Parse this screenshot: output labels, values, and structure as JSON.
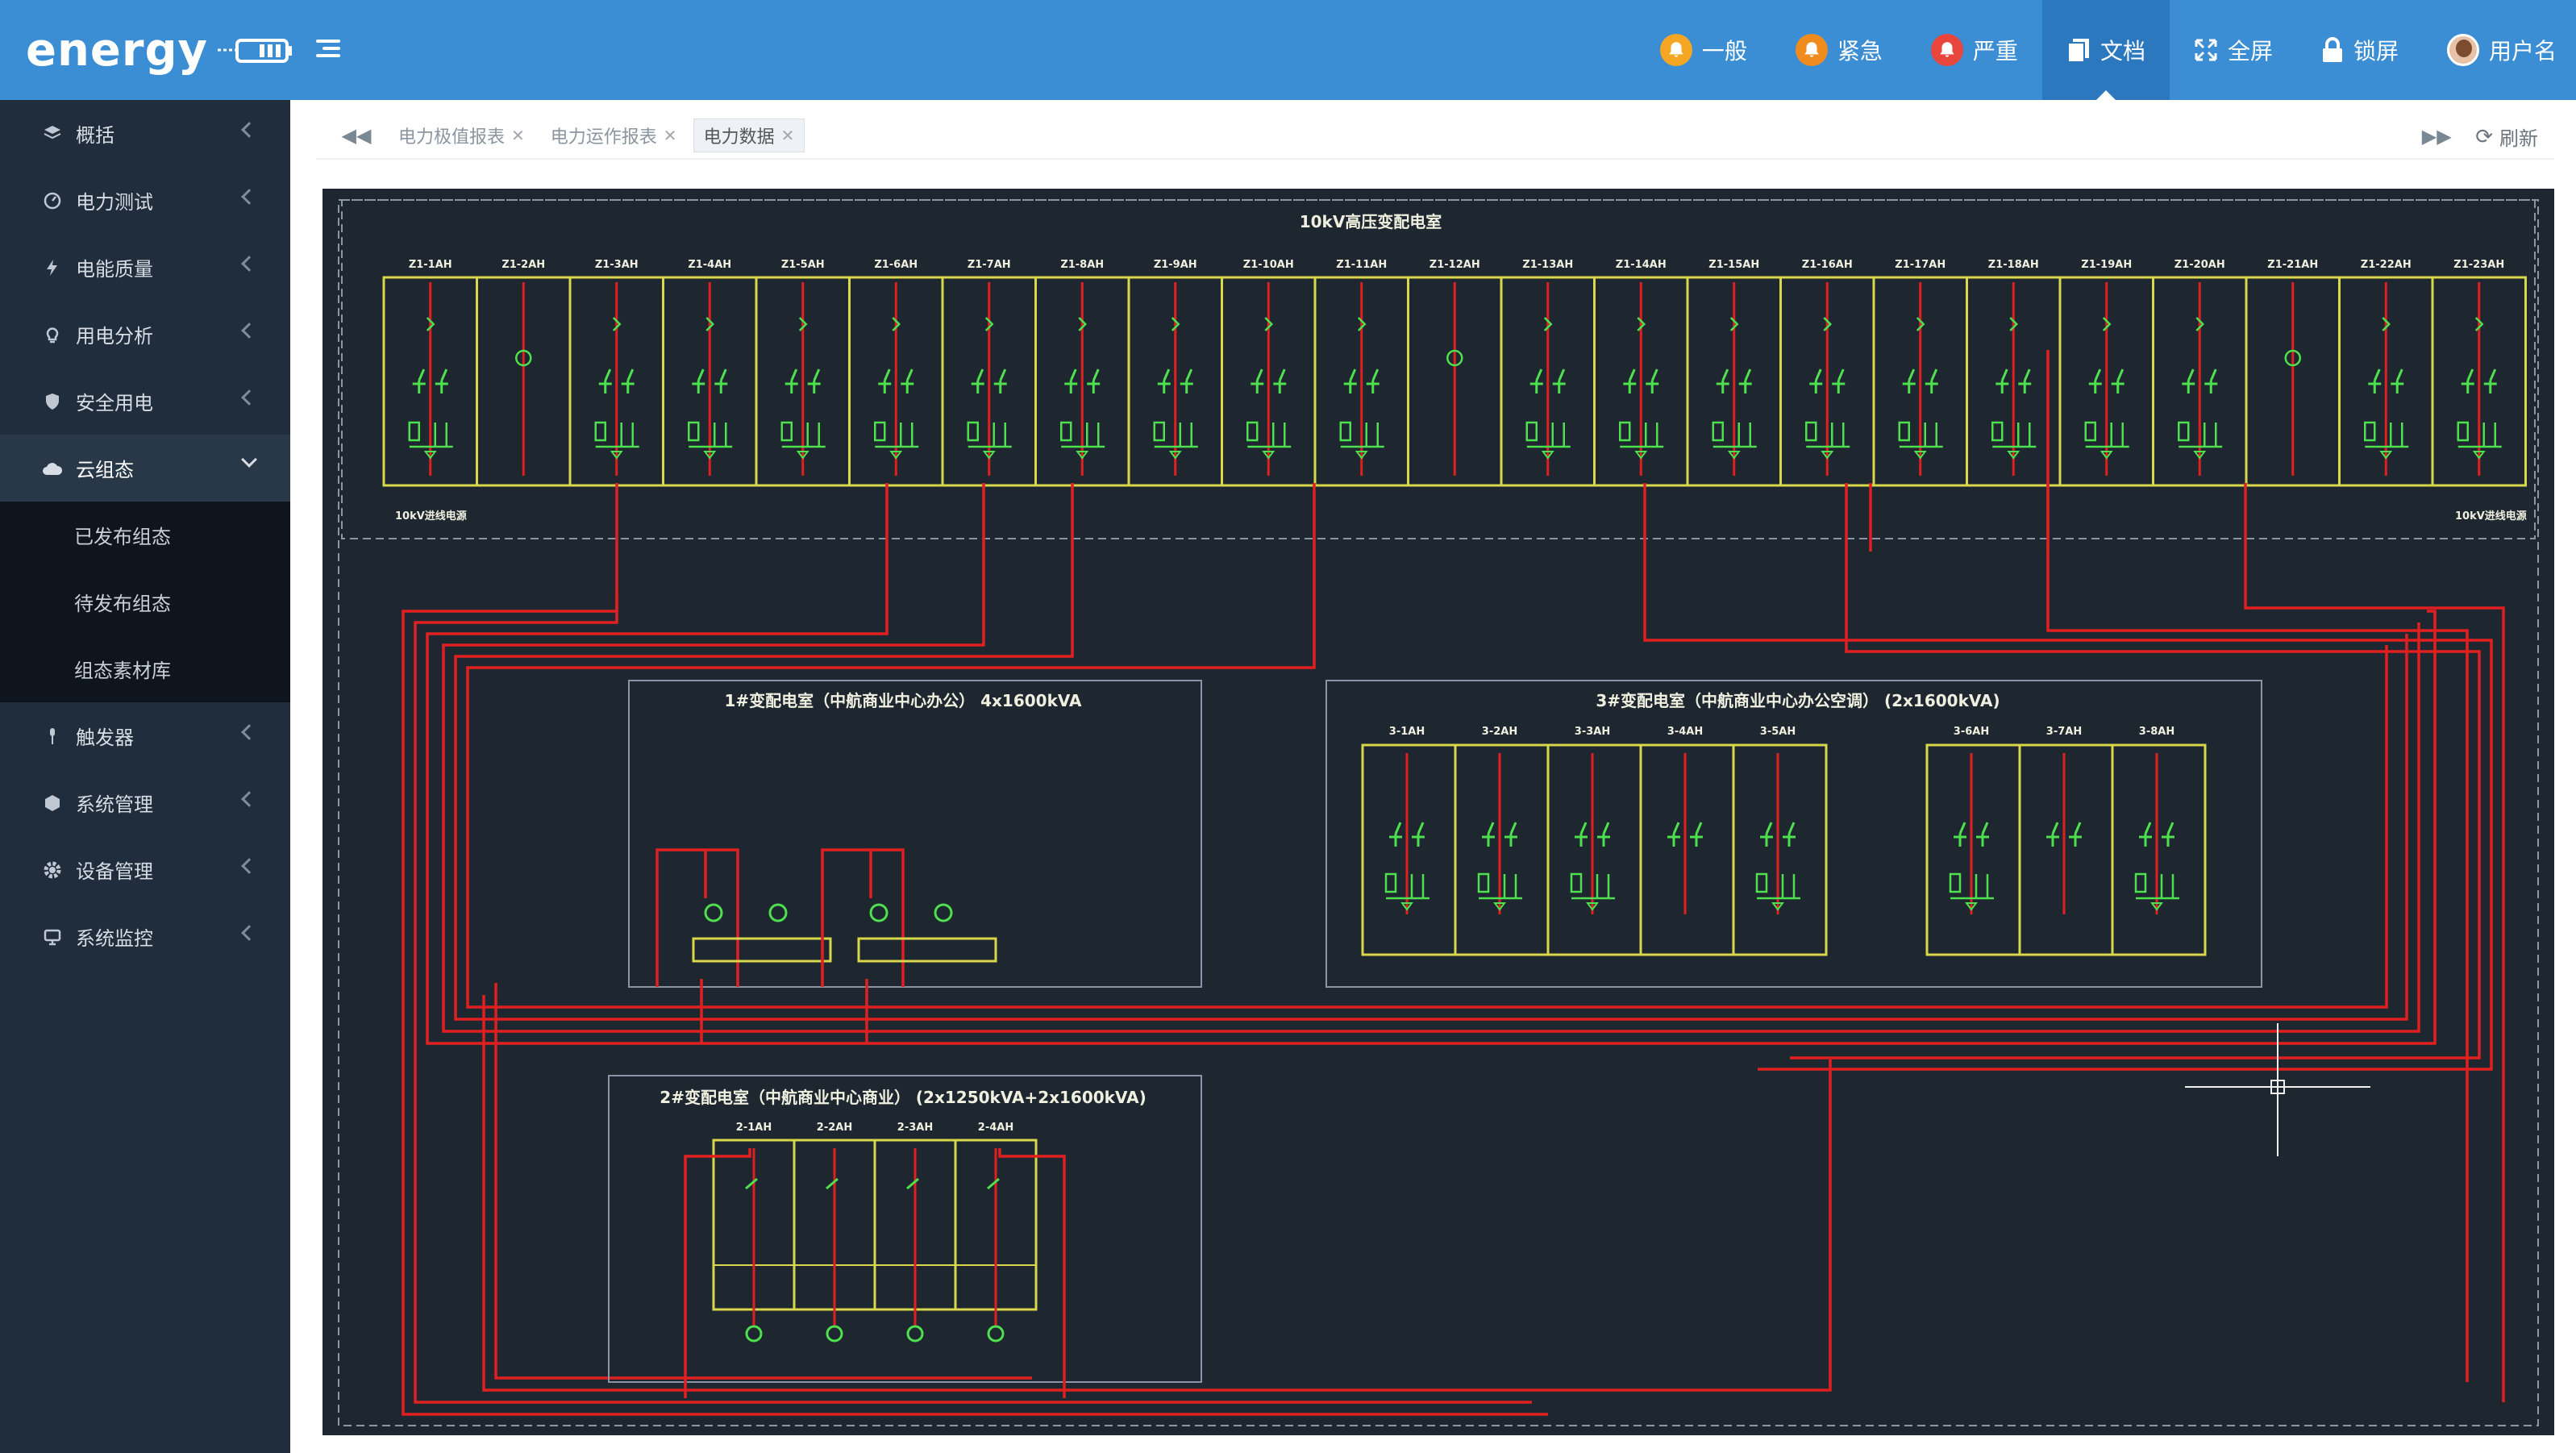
{
  "app": {
    "logo_text": "energy"
  },
  "header": {
    "alerts": [
      {
        "label": "一般",
        "color": "#f5a623"
      },
      {
        "label": "紧急",
        "color": "#f08c1e"
      },
      {
        "label": "严重",
        "color": "#e8453c"
      }
    ],
    "docs_label": "文档",
    "fullscreen_label": "全屏",
    "lock_label": "锁屏",
    "user_label": "用户名"
  },
  "sidebar": {
    "items": [
      {
        "label": "概括",
        "icon": "layers-icon"
      },
      {
        "label": "电力测试",
        "icon": "gauge-icon"
      },
      {
        "label": "电能质量",
        "icon": "bolt-icon"
      },
      {
        "label": "用电分析",
        "icon": "bulb-icon"
      },
      {
        "label": "安全用电",
        "icon": "shield-icon"
      },
      {
        "label": "云组态",
        "icon": "cloud-icon",
        "open": true
      },
      {
        "label": "触发器",
        "icon": "trigger-icon"
      },
      {
        "label": "系统管理",
        "icon": "cube-icon"
      },
      {
        "label": "设备管理",
        "icon": "gear-icon"
      },
      {
        "label": "系统监控",
        "icon": "monitor-icon"
      }
    ],
    "submenu": [
      {
        "label": "已发布组态"
      },
      {
        "label": "待发布组态"
      },
      {
        "label": "组态素材库"
      }
    ]
  },
  "tabs": {
    "items": [
      {
        "label": "电力极值报表",
        "active": false
      },
      {
        "label": "电力运作报表",
        "active": false
      },
      {
        "label": "电力数据",
        "active": true
      }
    ],
    "refresh_label": "刷新"
  },
  "diagram": {
    "hv_title": "10kV高压变配电室",
    "hv_cabinets": [
      "Z1-1AH",
      "Z1-2AH",
      "Z1-3AH",
      "Z1-4AH",
      "Z1-5AH",
      "Z1-6AH",
      "Z1-7AH",
      "Z1-8AH",
      "Z1-9AH",
      "Z1-10AH",
      "Z1-11AH",
      "Z1-12AH",
      "Z1-13AH",
      "Z1-14AH",
      "Z1-15AH",
      "Z1-16AH",
      "Z1-17AH",
      "Z1-18AH",
      "Z1-19AH",
      "Z1-20AH",
      "Z1-21AH",
      "Z1-22AH",
      "Z1-23AH"
    ],
    "hv_left_note": "10kV进线电源",
    "hv_right_note": "10kV进线电源",
    "sub1_title": "1#变配电室（中航商业中心办公） 4x1600kVA",
    "sub3_title": "3#变配电室（中航商业中心办公空调） (2x1600kVA)",
    "sub3_cabinets": [
      "3-1AH",
      "3-2AH",
      "3-3AH",
      "3-4AH",
      "3-5AH",
      "3-6AH",
      "3-7AH",
      "3-8AH"
    ],
    "sub2_title": "2#变配电室（中航商业中心商业） (2x1250kVA+2x1600kVA)",
    "sub2_cabinets": [
      "2-1AH",
      "2-2AH",
      "2-3AH",
      "2-4AH"
    ]
  }
}
